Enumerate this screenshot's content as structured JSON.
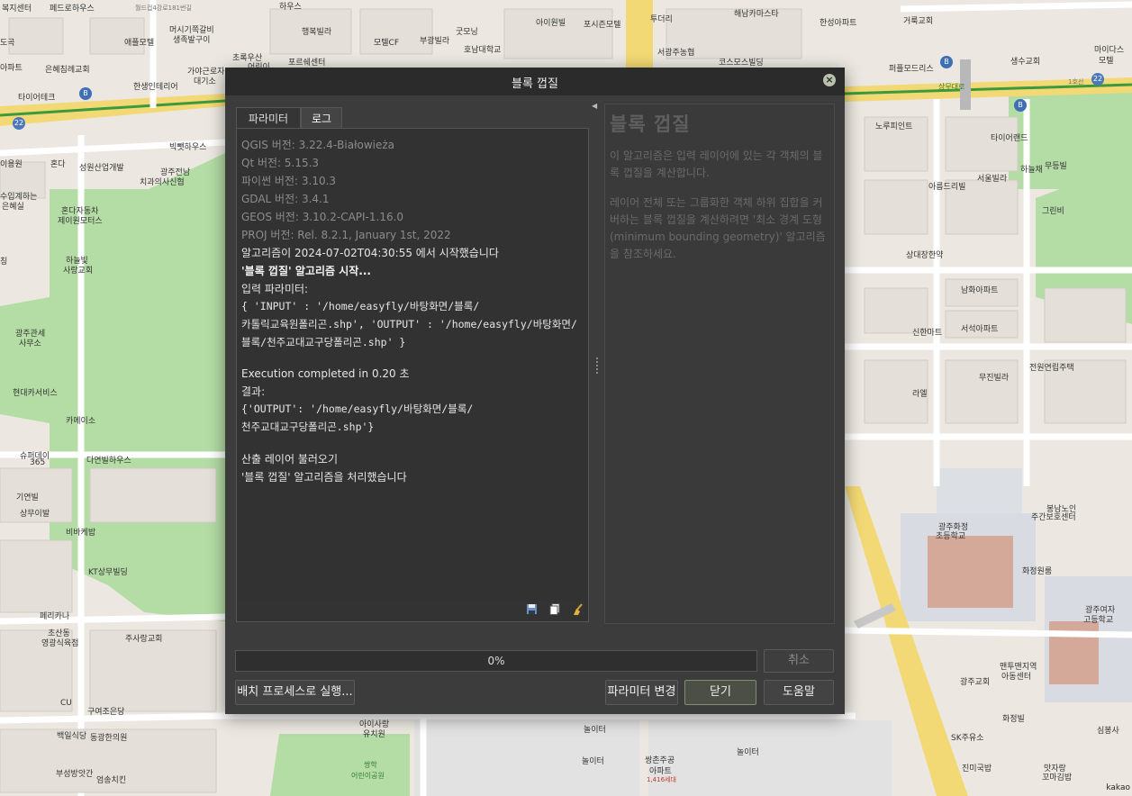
{
  "map": {
    "labels": [
      "복지센터",
      "페드로하우스",
      "월드컵4강로181번길",
      "하우스",
      "마이다스",
      "모텔",
      "도곡",
      "아파트",
      "은혜침례교회",
      "머시기쪽갈비",
      "생족발구이",
      "애플모텔",
      "초록우산",
      "어린이",
      "가야근로자",
      "대기소",
      "한생인테리어",
      "타이어테크",
      "포르쉐센터",
      "행복빌라",
      "모텔CF",
      "부광빌라",
      "굿모닝",
      "호남대학교",
      "아이원빌",
      "포시즌모텔",
      "투더리",
      "해남카마스타",
      "한성아파트",
      "거룩교회",
      "서광주농협",
      "코스모스빌딩",
      "퍼플모드리스",
      "생수교회",
      "상무대로",
      "1호선",
      "노루피인트",
      "타이어랜드",
      "하늘채",
      "무등빌",
      "서울빌라",
      "아름드리빌",
      "그린비",
      "상대장한약",
      "남화아파트",
      "서석아파트",
      "신한마트",
      "무진빌라",
      "전원연립주택",
      "라엘",
      "봉남노인",
      "주간보호센터",
      "광주화정",
      "초등학교",
      "화정원룸",
      "광주여자",
      "고등학교",
      "맨투맨지역",
      "아동센터",
      "광주교회",
      "화정빌",
      "SK주유소",
      "심봉사",
      "진미국밥",
      "맛자랑",
      "꼬마김밥",
      "쌍촌주공",
      "아파트",
      "1,416세대",
      "놀이터",
      "놀이터",
      "놀이터",
      "아이사랑",
      "유치원",
      "쌍학",
      "어린이공원",
      "부성방앗간",
      "엄송치킨",
      "백일식당",
      "동광한의원",
      "구여조은당",
      "CU",
      "주사랑교회",
      "초산동",
      "영광식육점",
      "페리카나",
      "KT상무빌딩",
      "비바케밥",
      "상무이발",
      "기연빌",
      "슈퍼데이",
      "365",
      "다연빌하우스",
      "카메이소",
      "현대카서비스",
      "광주관세",
      "사무소",
      "하늘빛",
      "사랑교회",
      "혼다자동차",
      "제이원모터스",
      "수입계하는",
      "은혜실",
      "빅뺏하우스",
      "광주전남",
      "치과의사신협",
      "성원산업개발",
      "혼다",
      "이용원",
      "칭"
    ]
  },
  "dialog": {
    "title": "블록 껍질",
    "tabs": [
      "파라미터",
      "로그"
    ],
    "log": {
      "version_lines": [
        "QGIS 버전: 3.22.4-Białowieża",
        "Qt 버전: 5.15.3",
        "파이썬 버전: 3.10.3",
        "GDAL 버전: 3.4.1",
        "GEOS 버전: 3.10.2-CAPI-1.16.0",
        "PROJ 버전: Rel. 8.2.1, January 1st, 2022"
      ],
      "started": "알고리즘이 2024-07-02T04:30:55 에서 시작했습니다",
      "algo_start": "'블록 껍질' 알고리즘 시작...",
      "input_params_label": "입력 파라미터:",
      "input_params": [
        "{ 'INPUT' : '/home/easyfly/바탕화면/블록/",
        "카톨릭교육원폴리곤.shp', 'OUTPUT' : '/home/easyfly/바탕화면/",
        "블록/천주교대교구당폴리곤.shp' }"
      ],
      "execution": "Execution completed in 0.20 초",
      "results_label": "결과:",
      "results": [
        "{'OUTPUT': '/home/easyfly/바탕화면/블록/",
        "천주교대교구당폴리곤.shp'}"
      ],
      "loading": "산출 레이어 불러오기",
      "finished": "'블록 껍질' 알고리즘을 처리했습니다"
    },
    "help": {
      "title": "블록 껍질",
      "paragraph1": "이 알고리즘은 입력 레이어에 있는 각 객체의 블록 껍질을 계산합니다.",
      "paragraph2": "레이어 전체 또는 그룹화한 객체 하위 집합을 커버하는 블록 껍질을 계산하려면 '최소 경계 도형(minimum bounding geometry)' 알고리즘을 참조하세요."
    },
    "progress": {
      "value": 0,
      "label": "0%"
    },
    "buttons": {
      "cancel": "취소",
      "batch": "배치 프로세스로 실행...",
      "change_params": "파라미터 변경",
      "close": "닫기",
      "help": "도움말"
    }
  },
  "kakao": "kakao"
}
